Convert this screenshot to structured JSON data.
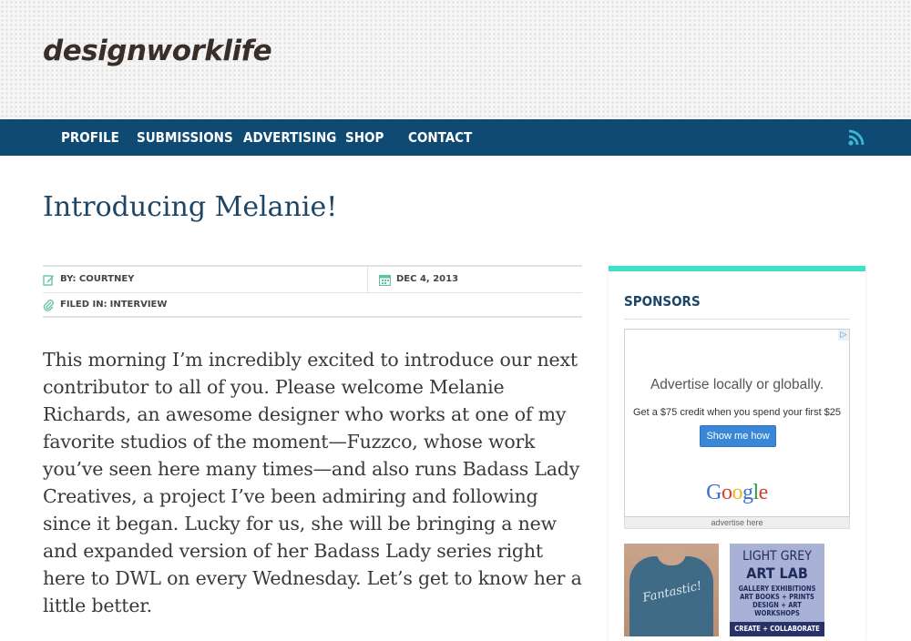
{
  "site": {
    "logo": "designworklife"
  },
  "nav": {
    "items": [
      "Profile",
      "Submissions",
      "Advertising",
      "Shop",
      "Contact"
    ],
    "rss_icon": "rss-icon"
  },
  "post": {
    "title": "Introducing Melanie!",
    "author_label": "By: Courtney",
    "date_label": "Dec 4, 2013",
    "filed_label": "Filed in:",
    "filed_category": "Interview",
    "body": "This morning I’m incredibly excited to introduce our next contributor to all of you. Please welcome Melanie Richards, an awesome designer who works at one of my favorite studios of the moment—Fuzzco, whose work you’ve seen here many times—and also runs Badass Lady Creatives, a project I’ve been admiring and following since it began. Lucky for us, she will be bringing a new and expanded version of her Badass Lady series right here to DWL on every Wednesday. Let’s get to know her a little better."
  },
  "sidebar": {
    "title": "Sponsors",
    "accent_color": "#3fe0c8",
    "ad": {
      "headline": "Advertise locally or globally.",
      "sub": "Get a $75 credit when you spend your first $25",
      "button": "Show me how",
      "brand": "Google",
      "footer": "advertise here"
    },
    "banner_shirt": {
      "text": "Fantastic!"
    },
    "banner_artlab": {
      "line1": "LIGHT GREY",
      "line2": "ART LAB",
      "line3": "GALLERY EXHIBITIONS",
      "line4": "ART BOOKS + PRINTS",
      "line5": "DESIGN + ART WORKSHOPS",
      "strip": "CREATE + COLLABORATE"
    }
  },
  "colors": {
    "nav_bg": "#0e4a72",
    "title": "#1d4566",
    "icon_green": "#5fc0a4"
  }
}
